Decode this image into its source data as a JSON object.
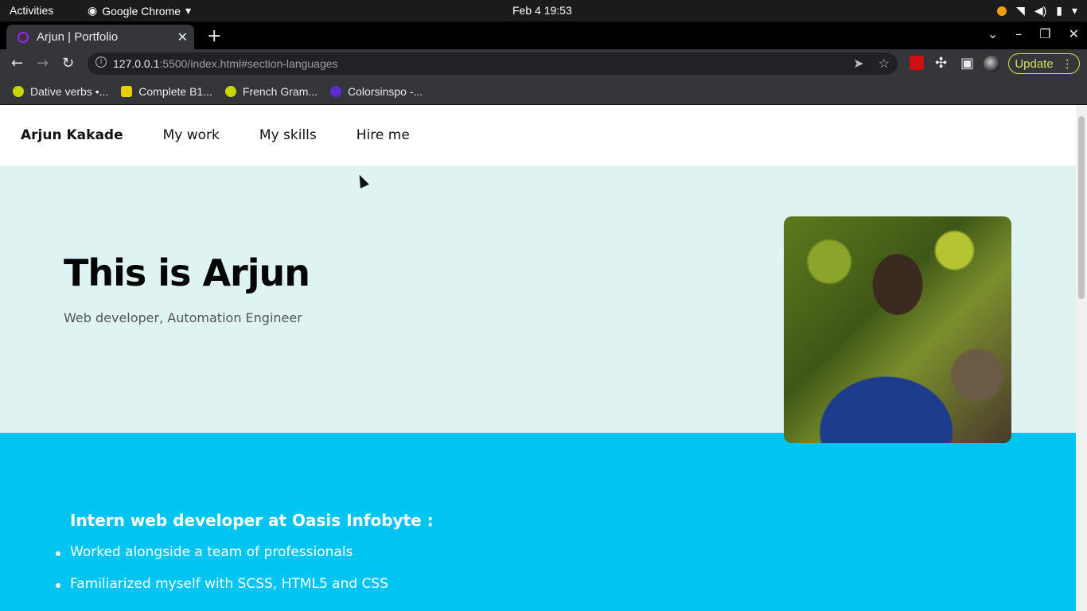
{
  "system": {
    "activities": "Activities",
    "app_name": "Google Chrome",
    "clock": "Feb 4  19:53"
  },
  "browser": {
    "tab_title": "Arjun | Portfolio",
    "url_host": "127.0.0.1",
    "url_rest": ":5500/index.html#section-languages",
    "update_label": "Update",
    "bookmarks": [
      "Dative verbs •...",
      "Complete B1...",
      "French Gram...",
      "Colorsinspo -..."
    ]
  },
  "page": {
    "brand": "Arjun Kakade",
    "nav": [
      "My work",
      "My skills",
      "Hire me"
    ],
    "hero_title": "This is Arjun",
    "hero_subtitle": "Web developer, Automation Engineer",
    "work_heading": "Intern web developer at Oasis Infobyte :",
    "work_items": [
      "Worked alongside a team of professionals",
      "Familiarized myself with SCSS, HTML5 and CSS"
    ]
  },
  "colors": {
    "hero_bg": "#e0f3f3",
    "work_bg": "#00c4f1",
    "update_accent": "#d4e157"
  }
}
